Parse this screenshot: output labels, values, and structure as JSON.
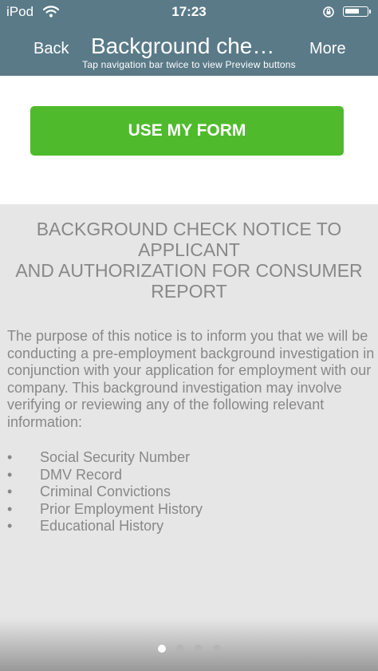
{
  "status_bar": {
    "carrier": "iPod",
    "time": "17:23"
  },
  "nav": {
    "back_label": "Back",
    "title": "Background che…",
    "more_label": "More",
    "hint": "Tap navigation bar twice to view Preview buttons"
  },
  "actions": {
    "use_form_label": "USE MY FORM"
  },
  "document": {
    "title_lines": [
      "BACKGROUND CHECK NOTICE TO",
      "APPLICANT",
      "AND AUTHORIZATION FOR CONSUMER",
      "REPORT"
    ],
    "paragraph": "The purpose of this notice is to inform you that we will be conducting a pre-employment background investigation in conjunction with your application for employment with our company. This background investigation may involve verifying or reviewing any of the following relevant information:",
    "bullet_glyph": "•",
    "items": [
      "Social Security Number",
      "DMV Record",
      "Criminal Convictions",
      "Prior Employment History",
      "Educational History"
    ]
  },
  "pager": {
    "count": 4,
    "active_index": 0
  },
  "colors": {
    "nav_bar": "#5a7a88",
    "button_green": "#4fbb2c",
    "doc_background": "#e6e6e6",
    "doc_text": "#888888"
  }
}
